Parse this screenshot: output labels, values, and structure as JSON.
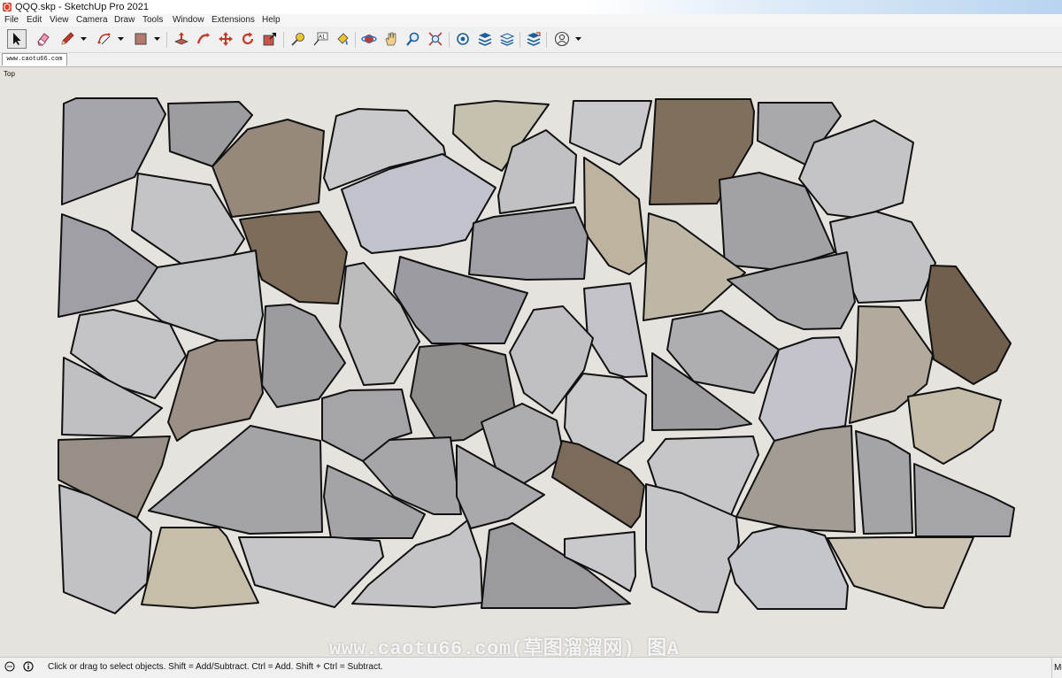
{
  "window": {
    "title": "QQQ.skp - SketchUp Pro 2021"
  },
  "menu": [
    "File",
    "Edit",
    "View",
    "Camera",
    "Draw",
    "Tools",
    "Window",
    "Extensions",
    "Help"
  ],
  "toolbar": {
    "tools": [
      "select-tool",
      "eraser-tool",
      "line-tool",
      "arc-tool",
      "shape-tool",
      "push-pull-tool",
      "follow-me-tool",
      "move-tool",
      "rotate-tool",
      "scale-tool",
      "tape-measure-tool",
      "text-tool",
      "paint-bucket-tool",
      "orbit-tool",
      "pan-tool",
      "zoom-tool",
      "zoom-extents-tool",
      "warehouse-tool",
      "extension-warehouse-tool",
      "layout-tool",
      "send-to-layout-tool",
      "profile-tool"
    ],
    "text_label": "A1"
  },
  "document_tab": {
    "label": "www.caotu66.com"
  },
  "viewport": {
    "view_label": "Top",
    "watermark": "www.caotu66.com(草图溜溜网) 图A"
  },
  "statusbar": {
    "text": "Click or drag to select objects. Shift = Add/Subtract. Ctrl = Add. Shift + Ctrl = Subtract.",
    "right_fragment": "Me"
  },
  "colors": {
    "stone_outline": "#111111",
    "background": "#e6e3de",
    "light_stone": "#c9c8cc",
    "dark_stone": "#a5a3a6",
    "brown_stone": "#8a7b69",
    "beige_stone": "#c8beaa"
  }
}
